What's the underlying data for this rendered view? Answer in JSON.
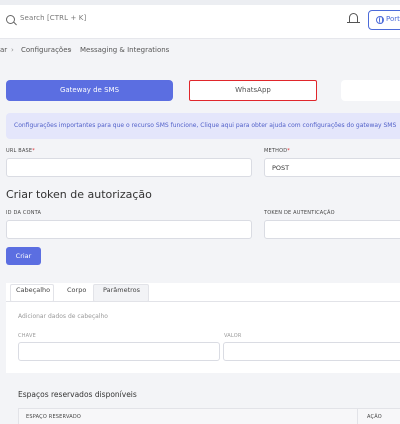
{
  "header": {
    "search_placeholder": "Search [CTRL + K]",
    "portal_label": "Portal"
  },
  "breadcrumb": {
    "items": [
      "ar",
      "Configurações",
      "Messaging & Integrations"
    ]
  },
  "tabs": {
    "sms": "Gateway de SMS",
    "whatsapp": "WhatsApp"
  },
  "banner": {
    "text": "Configurações importantes para que o recurso SMS funcione, Clique aqui para obter ajuda com configurações do gateway SMS"
  },
  "form": {
    "url_label": "URL BASE",
    "method_label": "METHOD",
    "method_value": "POST"
  },
  "token": {
    "title": "Criar token de autorização",
    "account_id_label": "ID DA CONTA",
    "auth_token_label": "TOKEN DE AUTENTICAÇÃO",
    "create_button": "Criar"
  },
  "subtabs": {
    "header": "Cabeçalho",
    "body": "Corpo",
    "params": "Parâmetros"
  },
  "header_data": {
    "hint": "Adicionar dados de cabeçalho",
    "key_label": "CHAVE",
    "value_label": "VALOR"
  },
  "placeholders": {
    "title": "Espaços reservados disponíveis",
    "col_placeholder": "ESPAÇO RESERVADO",
    "col_action": "AÇÃO"
  }
}
